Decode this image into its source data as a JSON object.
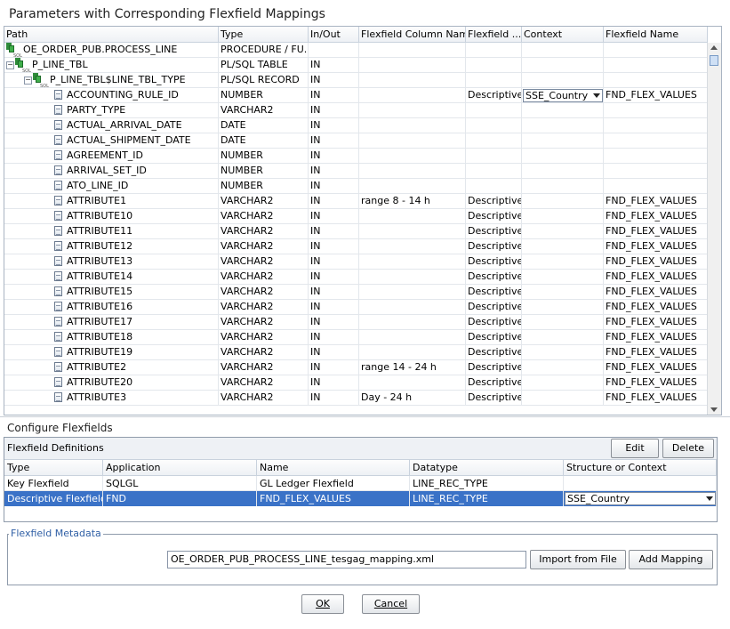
{
  "title": "Parameters with Corresponding Flexfield Mappings",
  "params_grid": {
    "columns": [
      "Path",
      "Type",
      "In/Out",
      "Flexfield Column Name",
      "Flexfield ...",
      "Context",
      "Flexfield Name"
    ],
    "rows": [
      {
        "indent": 0,
        "icon": "sql",
        "expander": "",
        "path": "OE_ORDER_PUB.PROCESS_LINE",
        "type": "PROCEDURE / FU...",
        "inout": "",
        "colname": "",
        "ftype": "",
        "context": "",
        "fname": ""
      },
      {
        "indent": 1,
        "icon": "sql",
        "expander": "−",
        "path": "P_LINE_TBL",
        "type": "PL/SQL TABLE",
        "inout": "IN",
        "colname": "",
        "ftype": "",
        "context": "",
        "fname": ""
      },
      {
        "indent": 2,
        "icon": "sql",
        "expander": "−",
        "path": "P_LINE_TBL$LINE_TBL_TYPE",
        "type": "PL/SQL RECORD",
        "inout": "IN",
        "colname": "",
        "ftype": "",
        "context": "",
        "fname": ""
      },
      {
        "indent": 3,
        "icon": "doc",
        "expander": "",
        "path": "ACCOUNTING_RULE_ID",
        "type": "NUMBER",
        "inout": "IN",
        "colname": "",
        "ftype": "Descriptive",
        "context": "SSE_Country",
        "fname": "FND_FLEX_VALUES"
      },
      {
        "indent": 3,
        "icon": "doc",
        "expander": "",
        "path": "PARTY_TYPE",
        "type": "VARCHAR2",
        "inout": "IN",
        "colname": "",
        "ftype": "",
        "context": "",
        "fname": ""
      },
      {
        "indent": 3,
        "icon": "doc",
        "expander": "",
        "path": "ACTUAL_ARRIVAL_DATE",
        "type": "DATE",
        "inout": "IN",
        "colname": "",
        "ftype": "",
        "context": "",
        "fname": ""
      },
      {
        "indent": 3,
        "icon": "doc",
        "expander": "",
        "path": "ACTUAL_SHIPMENT_DATE",
        "type": "DATE",
        "inout": "IN",
        "colname": "",
        "ftype": "",
        "context": "",
        "fname": ""
      },
      {
        "indent": 3,
        "icon": "doc",
        "expander": "",
        "path": "AGREEMENT_ID",
        "type": "NUMBER",
        "inout": "IN",
        "colname": "",
        "ftype": "",
        "context": "",
        "fname": ""
      },
      {
        "indent": 3,
        "icon": "doc",
        "expander": "",
        "path": "ARRIVAL_SET_ID",
        "type": "NUMBER",
        "inout": "IN",
        "colname": "",
        "ftype": "",
        "context": "",
        "fname": ""
      },
      {
        "indent": 3,
        "icon": "doc",
        "expander": "",
        "path": "ATO_LINE_ID",
        "type": "NUMBER",
        "inout": "IN",
        "colname": "",
        "ftype": "",
        "context": "",
        "fname": ""
      },
      {
        "indent": 3,
        "icon": "doc",
        "expander": "",
        "path": "ATTRIBUTE1",
        "type": "VARCHAR2",
        "inout": "IN",
        "colname": "range  8 - 14 h",
        "ftype": "Descriptive",
        "context": "",
        "fname": "FND_FLEX_VALUES"
      },
      {
        "indent": 3,
        "icon": "doc",
        "expander": "",
        "path": "ATTRIBUTE10",
        "type": "VARCHAR2",
        "inout": "IN",
        "colname": "",
        "ftype": "Descriptive",
        "context": "",
        "fname": "FND_FLEX_VALUES"
      },
      {
        "indent": 3,
        "icon": "doc",
        "expander": "",
        "path": "ATTRIBUTE11",
        "type": "VARCHAR2",
        "inout": "IN",
        "colname": "",
        "ftype": "Descriptive",
        "context": "",
        "fname": "FND_FLEX_VALUES"
      },
      {
        "indent": 3,
        "icon": "doc",
        "expander": "",
        "path": "ATTRIBUTE12",
        "type": "VARCHAR2",
        "inout": "IN",
        "colname": "",
        "ftype": "Descriptive",
        "context": "",
        "fname": "FND_FLEX_VALUES"
      },
      {
        "indent": 3,
        "icon": "doc",
        "expander": "",
        "path": "ATTRIBUTE13",
        "type": "VARCHAR2",
        "inout": "IN",
        "colname": "",
        "ftype": "Descriptive",
        "context": "",
        "fname": "FND_FLEX_VALUES"
      },
      {
        "indent": 3,
        "icon": "doc",
        "expander": "",
        "path": "ATTRIBUTE14",
        "type": "VARCHAR2",
        "inout": "IN",
        "colname": "",
        "ftype": "Descriptive",
        "context": "",
        "fname": "FND_FLEX_VALUES"
      },
      {
        "indent": 3,
        "icon": "doc",
        "expander": "",
        "path": "ATTRIBUTE15",
        "type": "VARCHAR2",
        "inout": "IN",
        "colname": "",
        "ftype": "Descriptive",
        "context": "",
        "fname": "FND_FLEX_VALUES"
      },
      {
        "indent": 3,
        "icon": "doc",
        "expander": "",
        "path": "ATTRIBUTE16",
        "type": "VARCHAR2",
        "inout": "IN",
        "colname": "",
        "ftype": "Descriptive",
        "context": "",
        "fname": "FND_FLEX_VALUES"
      },
      {
        "indent": 3,
        "icon": "doc",
        "expander": "",
        "path": "ATTRIBUTE17",
        "type": "VARCHAR2",
        "inout": "IN",
        "colname": "",
        "ftype": "Descriptive",
        "context": "",
        "fname": "FND_FLEX_VALUES"
      },
      {
        "indent": 3,
        "icon": "doc",
        "expander": "",
        "path": "ATTRIBUTE18",
        "type": "VARCHAR2",
        "inout": "IN",
        "colname": "",
        "ftype": "Descriptive",
        "context": "",
        "fname": "FND_FLEX_VALUES"
      },
      {
        "indent": 3,
        "icon": "doc",
        "expander": "",
        "path": "ATTRIBUTE19",
        "type": "VARCHAR2",
        "inout": "IN",
        "colname": "",
        "ftype": "Descriptive",
        "context": "",
        "fname": "FND_FLEX_VALUES"
      },
      {
        "indent": 3,
        "icon": "doc",
        "expander": "",
        "path": "ATTRIBUTE2",
        "type": "VARCHAR2",
        "inout": "IN",
        "colname": "range 14 - 24 h",
        "ftype": "Descriptive",
        "context": "",
        "fname": "FND_FLEX_VALUES"
      },
      {
        "indent": 3,
        "icon": "doc",
        "expander": "",
        "path": "ATTRIBUTE20",
        "type": "VARCHAR2",
        "inout": "IN",
        "colname": "",
        "ftype": "Descriptive",
        "context": "",
        "fname": "FND_FLEX_VALUES"
      },
      {
        "indent": 3,
        "icon": "doc",
        "expander": "",
        "path": "ATTRIBUTE3",
        "type": "VARCHAR2",
        "inout": "IN",
        "colname": "Day - 24 h",
        "ftype": "Descriptive",
        "context": "",
        "fname": "FND_FLEX_VALUES"
      }
    ]
  },
  "configure": {
    "title": "Configure Flexfields",
    "definitions_label": "Flexfield Definitions",
    "edit_label": "Edit",
    "delete_label": "Delete",
    "columns": [
      "Type",
      "Application",
      "Name",
      "Datatype",
      "Structure or Context"
    ],
    "rows": [
      {
        "type": "Key Flexfield",
        "application": "SQLGL",
        "name": "GL Ledger Flexfield",
        "datatype": "LINE_REC_TYPE",
        "context": "",
        "selected": false
      },
      {
        "type": "Descriptive Flexfield",
        "application": "FND",
        "name": "FND_FLEX_VALUES",
        "datatype": "LINE_REC_TYPE",
        "context": "SSE_Country",
        "selected": true
      }
    ]
  },
  "metadata": {
    "legend": "Flexfield Metadata",
    "file_value": "OE_ORDER_PUB_PROCESS_LINE_tesgag_mapping.xml",
    "import_label": "Import from File",
    "add_label": "Add Mapping"
  },
  "footer": {
    "ok_label": "OK",
    "cancel_label": "Cancel"
  },
  "colors": {
    "selection": "#3a72c7",
    "legend_text": "#2f5fa5"
  }
}
